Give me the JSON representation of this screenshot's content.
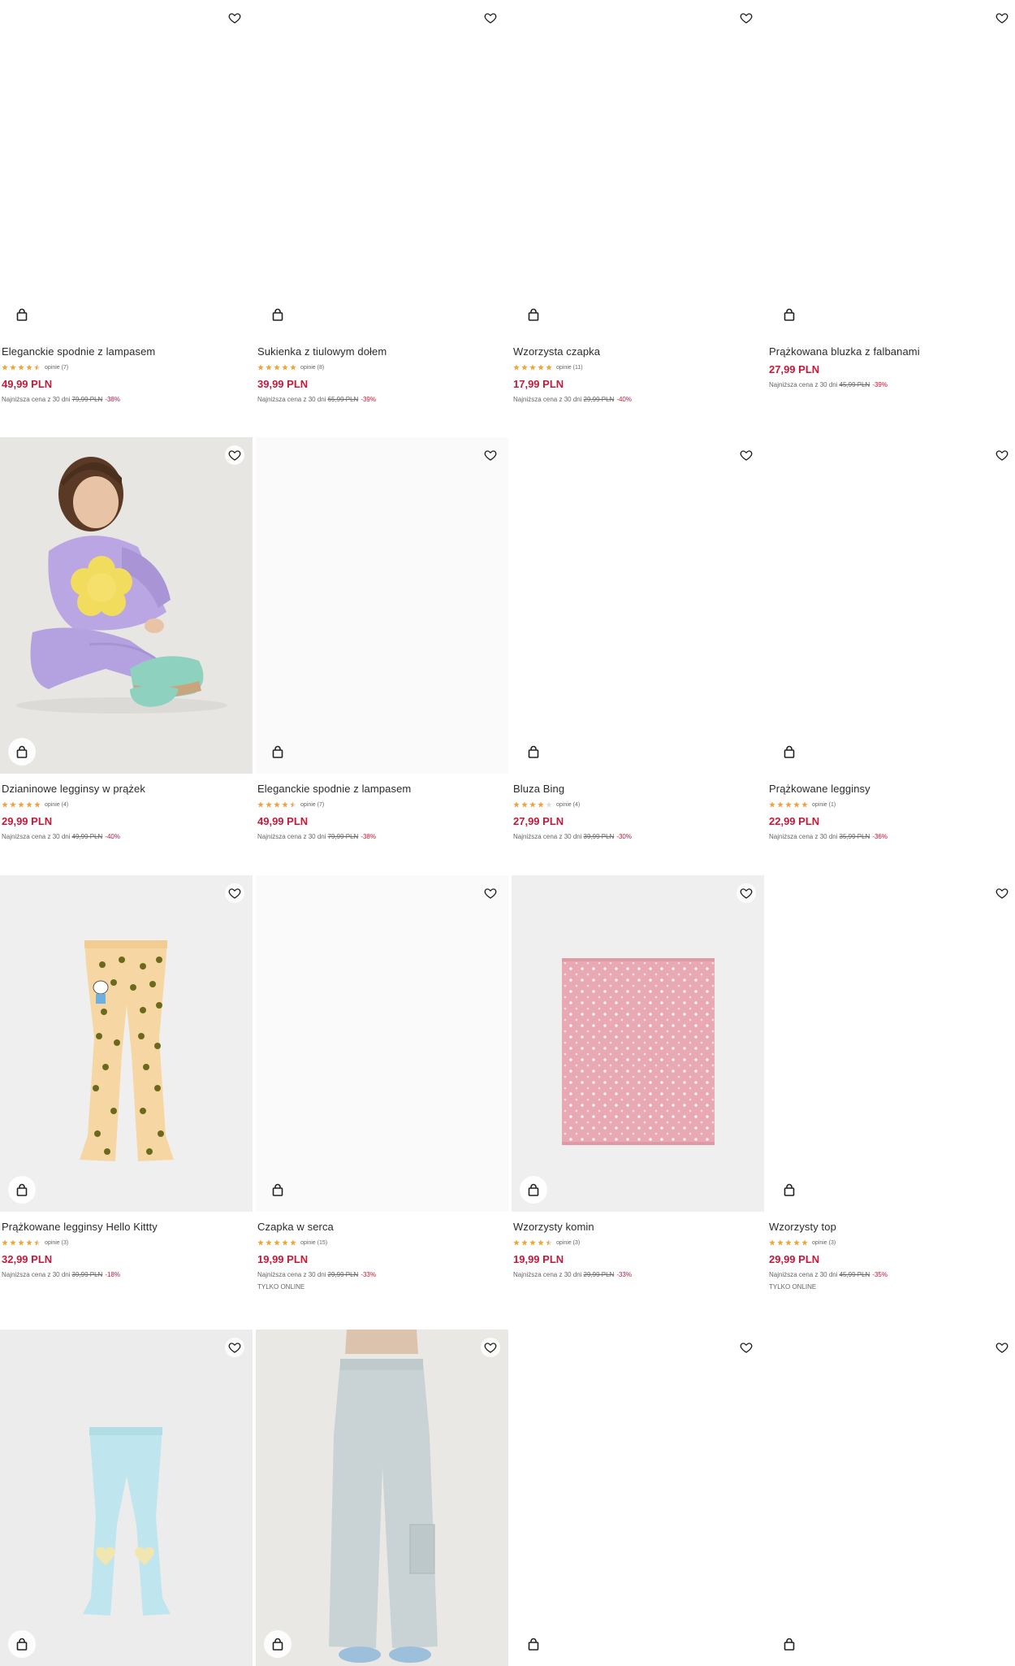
{
  "lowest_label": "Najniższa cena z 30 dni",
  "colors": {
    "price": "#c41a3a",
    "star": "#f2a33a",
    "star_empty": "#dddddd"
  },
  "products": [
    {
      "title": "Eleganckie spodnie z lampasem",
      "rating": 4.5,
      "reviews": "opinie (7)",
      "price": "49,99 PLN",
      "old_price": "79,99 PLN",
      "discount": "-38%"
    },
    {
      "title": "Sukienka z tiulowym dołem",
      "rating": 5,
      "reviews": "opinie (8)",
      "price": "39,99 PLN",
      "old_price": "65,99 PLN",
      "discount": "-39%"
    },
    {
      "title": "Wzorzysta czapka",
      "rating": 5,
      "reviews": "opinie (11)",
      "price": "17,99 PLN",
      "old_price": "29,99 PLN",
      "discount": "-40%"
    },
    {
      "title": "Prążkowana bluzka z falbanami",
      "price": "27,99 PLN",
      "old_price": "45,99 PLN",
      "discount": "-39%"
    },
    {
      "title": "Dzianinowe legginsy w prążek",
      "rating": 5,
      "reviews": "opinie (4)",
      "price": "29,99 PLN",
      "old_price": "49,99 PLN",
      "discount": "-40%"
    },
    {
      "title": "Eleganckie spodnie z lampasem",
      "rating": 4.5,
      "reviews": "opinie (7)",
      "price": "49,99 PLN",
      "old_price": "79,99 PLN",
      "discount": "-38%"
    },
    {
      "title": "Bluza Bing",
      "rating": 4,
      "reviews": "opinie (4)",
      "price": "27,99 PLN",
      "old_price": "39,99 PLN",
      "discount": "-30%"
    },
    {
      "title": "Prążkowane legginsy",
      "rating": 5,
      "reviews": "opinie (1)",
      "price": "22,99 PLN",
      "old_price": "35,99 PLN",
      "discount": "-36%"
    },
    {
      "title": "Prążkowane legginsy Hello Kittty",
      "rating": 4.5,
      "reviews": "opinie (3)",
      "price": "32,99 PLN",
      "old_price": "39,99 PLN",
      "discount": "-18%"
    },
    {
      "title": "Czapka w serca",
      "rating": 5,
      "reviews": "opinie (15)",
      "price": "19,99 PLN",
      "old_price": "29,99 PLN",
      "discount": "-33%",
      "online": "TYLKO ONLINE"
    },
    {
      "title": "Wzorzysty komin",
      "rating": 4.5,
      "reviews": "opinie (3)",
      "price": "19,99 PLN",
      "old_price": "29,99 PLN",
      "discount": "-33%"
    },
    {
      "title": "Wzorzysty top",
      "rating": 5,
      "reviews": "opinie (3)",
      "price": "29,99 PLN",
      "old_price": "45,99 PLN",
      "discount": "-35%",
      "online": "TYLKO ONLINE"
    },
    {},
    {},
    {},
    {}
  ]
}
